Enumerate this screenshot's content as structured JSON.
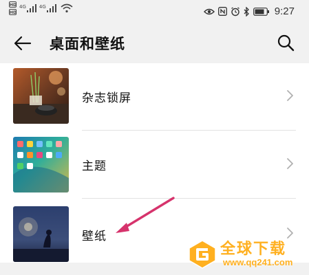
{
  "status_bar": {
    "hd_label": "HD",
    "sig1_label": "4G",
    "sig2_label": "4G",
    "time": "9:27"
  },
  "header": {
    "title": "桌面和壁纸",
    "back_icon": "arrow-left-icon",
    "search_icon": "search-icon"
  },
  "list": {
    "items": [
      {
        "label": "杂志锁屏",
        "thumb": "magazine-lockscreen-thumbnail"
      },
      {
        "label": "主题",
        "thumb": "theme-thumbnail"
      },
      {
        "label": "壁纸",
        "thumb": "wallpaper-thumbnail"
      }
    ]
  },
  "annotation": {
    "color": "#d6336c"
  },
  "watermark": {
    "text": "全球下载",
    "url": "www.qq241.com",
    "color": "#ffb020"
  }
}
